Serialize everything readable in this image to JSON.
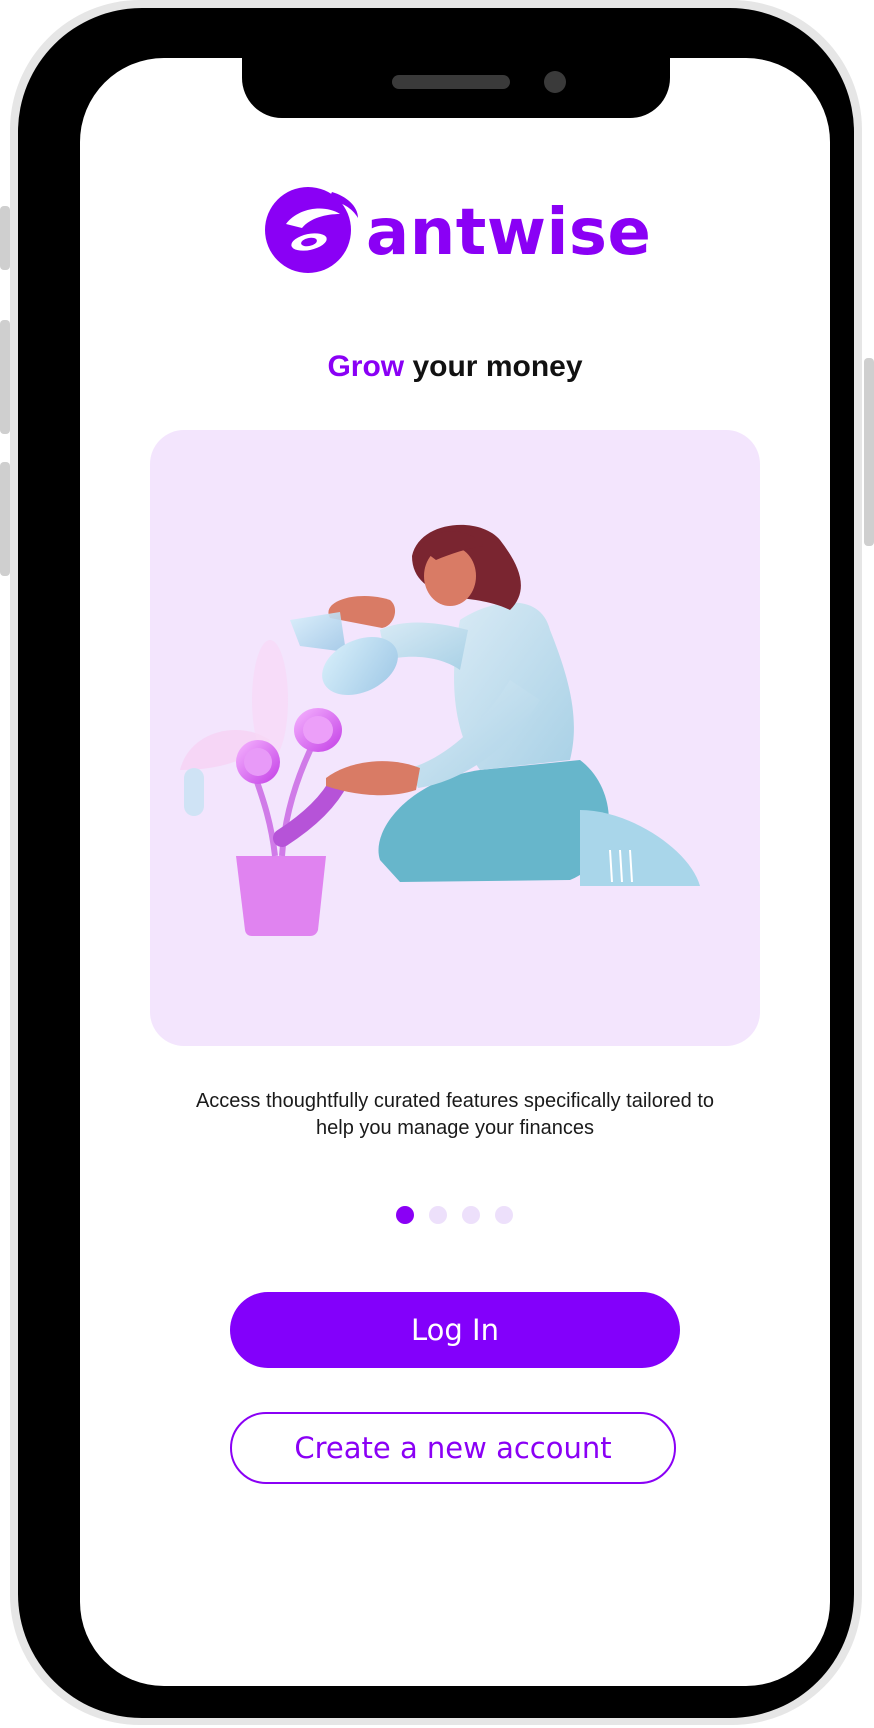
{
  "brand": {
    "name": "antwise",
    "logo_icon": "antwise-logo-icon",
    "color": "#8a00f5"
  },
  "headline": {
    "accent": "Grow",
    "rest": " your money"
  },
  "illustration": {
    "icon": "woman-watering-coin-plant-illustration",
    "background": "#f3e5fd"
  },
  "description": "Access  thoughtfully curated features specifically tailored to help you manage your finances",
  "carousel": {
    "total_pages": 4,
    "active_page": 1
  },
  "actions": {
    "login_label": "Log In",
    "create_account_label": "Create a new account"
  }
}
